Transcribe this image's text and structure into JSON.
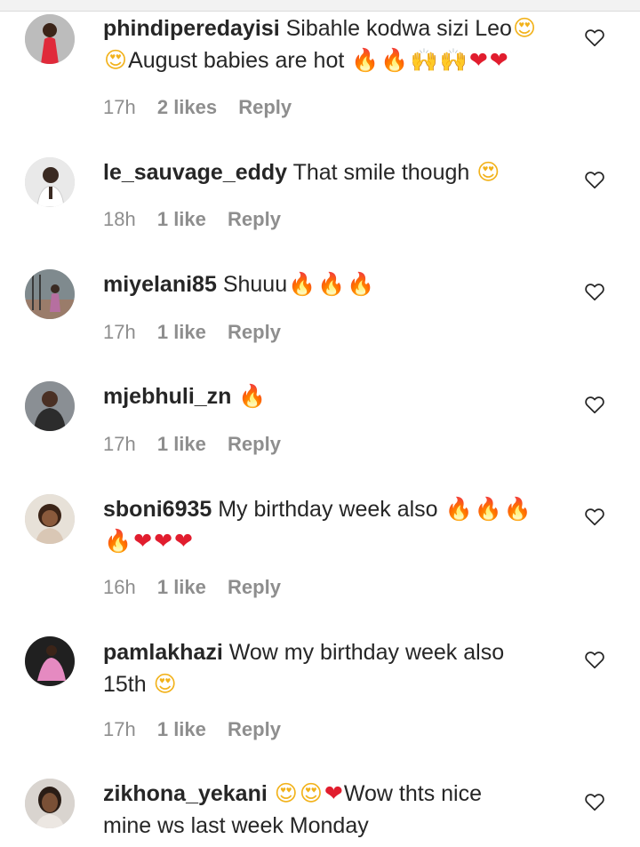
{
  "comments": [
    {
      "username": "phindiperedayisi",
      "text_line1": "Sibahle kodwa sizi Leo",
      "text_line2": "August babies are hot",
      "time": "17h",
      "likes": "2 likes",
      "reply": "Reply",
      "avatar_colors": [
        "#bcbcbc",
        "#e02a3a"
      ]
    },
    {
      "username": "le_sauvage_eddy",
      "text_line1": "That smile though",
      "time": "18h",
      "likes": "1 like",
      "reply": "Reply",
      "avatar_colors": [
        "#e9e9e9",
        "#3a2a22"
      ]
    },
    {
      "username": "miyelani85",
      "text_line1": "Shuuu",
      "time": "17h",
      "likes": "1 like",
      "reply": "Reply",
      "avatar_colors": [
        "#7f8a8e",
        "#b66fa0"
      ]
    },
    {
      "username": "mjebhuli_zn",
      "text_line1": "",
      "time": "17h",
      "likes": "1 like",
      "reply": "Reply",
      "avatar_colors": [
        "#8a8f94",
        "#2c2c2c"
      ]
    },
    {
      "username": "sboni6935",
      "text_line1": "My birthday week also",
      "time": "16h",
      "likes": "1 like",
      "reply": "Reply",
      "avatar_colors": [
        "#e7e1d8",
        "#3b2417"
      ]
    },
    {
      "username": "pamlakhazi",
      "text_line1": "Wow my birthday week also",
      "text_line2": "15th",
      "time": "17h",
      "likes": "1 like",
      "reply": "Reply",
      "avatar_colors": [
        "#202020",
        "#e58ac1"
      ]
    },
    {
      "username": "zikhona_yekani",
      "text_line1": "Wow thts nice",
      "text_line2": "mine ws last week Monday",
      "avatar_colors": [
        "#d9d4cf",
        "#2a1d16"
      ]
    }
  ],
  "icons": {
    "like": "heart-outline-icon",
    "fire": "fire-emoji",
    "heart": "red-heart-emoji",
    "smile": "heart-eyes-emoji",
    "hands": "raised-hands-emoji"
  },
  "colors": {
    "text": "#262626",
    "meta": "#8e8e8e",
    "fire": "#ff5a00",
    "heart": "#e11d2e"
  }
}
